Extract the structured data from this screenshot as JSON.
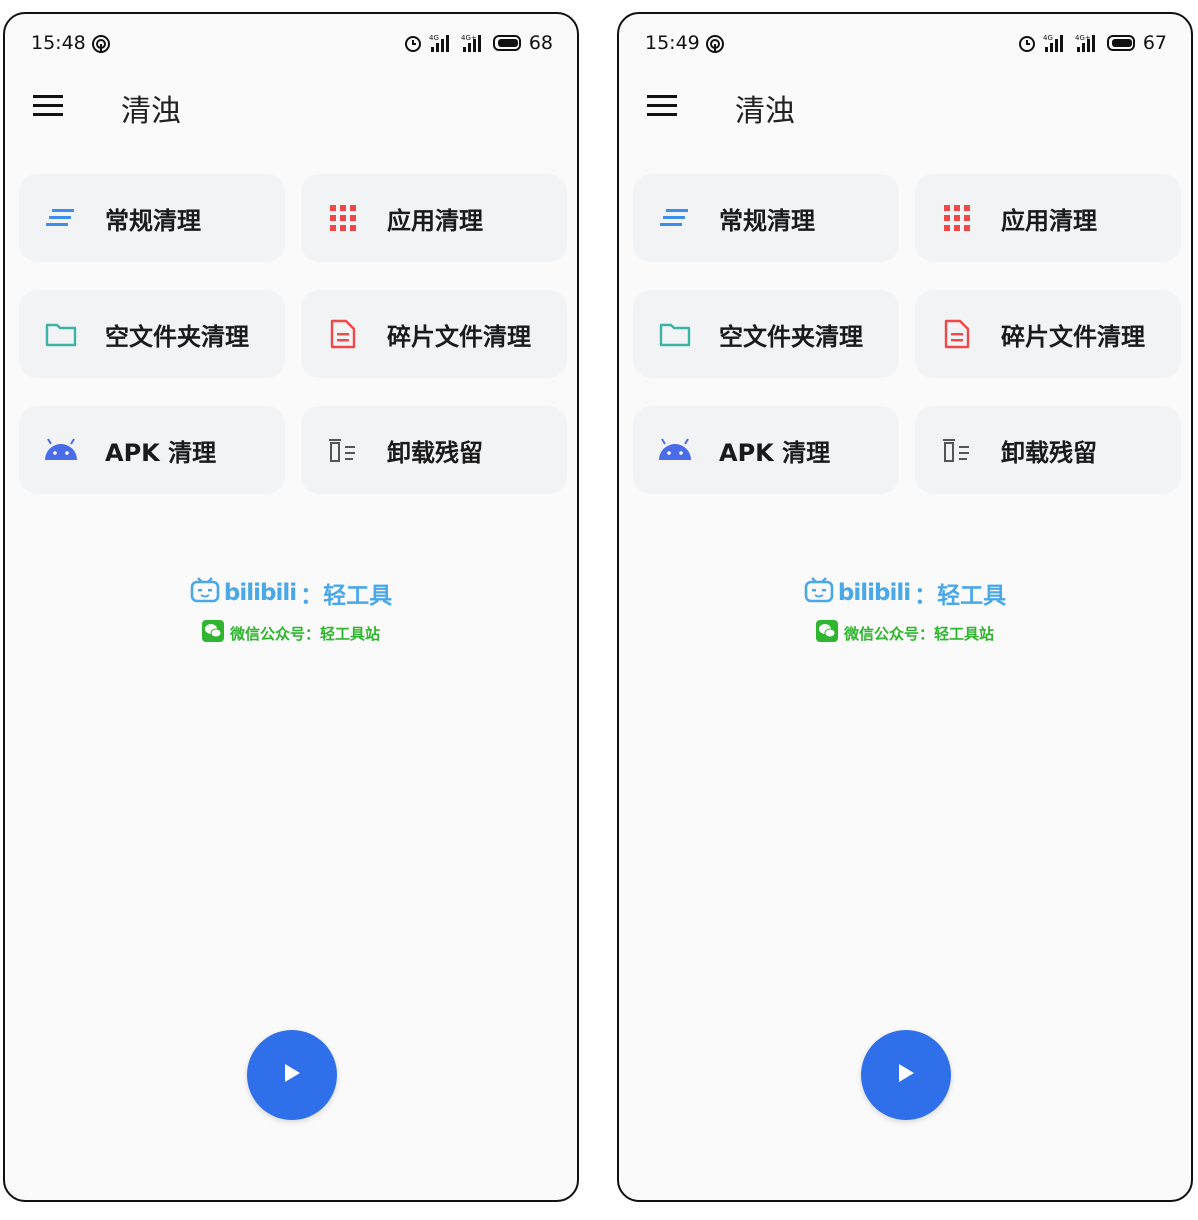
{
  "screens": [
    {
      "status": {
        "time": "15:48",
        "battery": "68"
      },
      "app_title": "清浊",
      "cards": [
        {
          "label": "常规清理",
          "icon": "lines-icon"
        },
        {
          "label": "应用清理",
          "icon": "apps-grid-icon"
        },
        {
          "label": "空文件夹清理",
          "icon": "folder-icon"
        },
        {
          "label": "碎片文件清理",
          "icon": "document-icon"
        },
        {
          "label": "APK 清理",
          "icon": "android-icon"
        },
        {
          "label": "卸载残留",
          "icon": "trash-list-icon"
        }
      ],
      "watermark": {
        "brand": "bilibili",
        "line1": "：轻工具",
        "line2": "微信公众号：轻工具站"
      }
    },
    {
      "status": {
        "time": "15:49",
        "battery": "67"
      },
      "app_title": "清浊",
      "cards": [
        {
          "label": "常规清理",
          "icon": "lines-icon"
        },
        {
          "label": "应用清理",
          "icon": "apps-grid-icon"
        },
        {
          "label": "空文件夹清理",
          "icon": "folder-icon"
        },
        {
          "label": "碎片文件清理",
          "icon": "document-icon"
        },
        {
          "label": "APK 清理",
          "icon": "android-icon"
        },
        {
          "label": "卸载残留",
          "icon": "trash-list-icon"
        }
      ],
      "watermark": {
        "brand": "bilibili",
        "line1": "：轻工具",
        "line2": "微信公众号：轻工具站"
      }
    }
  ],
  "colors": {
    "accent": "#2f6fea",
    "card_bg": "#f2f3f5",
    "lines_icon": "#3b8ef0",
    "apps_icon": "#f04848",
    "folder_icon": "#3cb3a4",
    "document_icon": "#f04848",
    "android_icon": "#4a6ce8",
    "watermark_blue": "#4aa8e8",
    "watermark_green": "#2fb52f"
  }
}
